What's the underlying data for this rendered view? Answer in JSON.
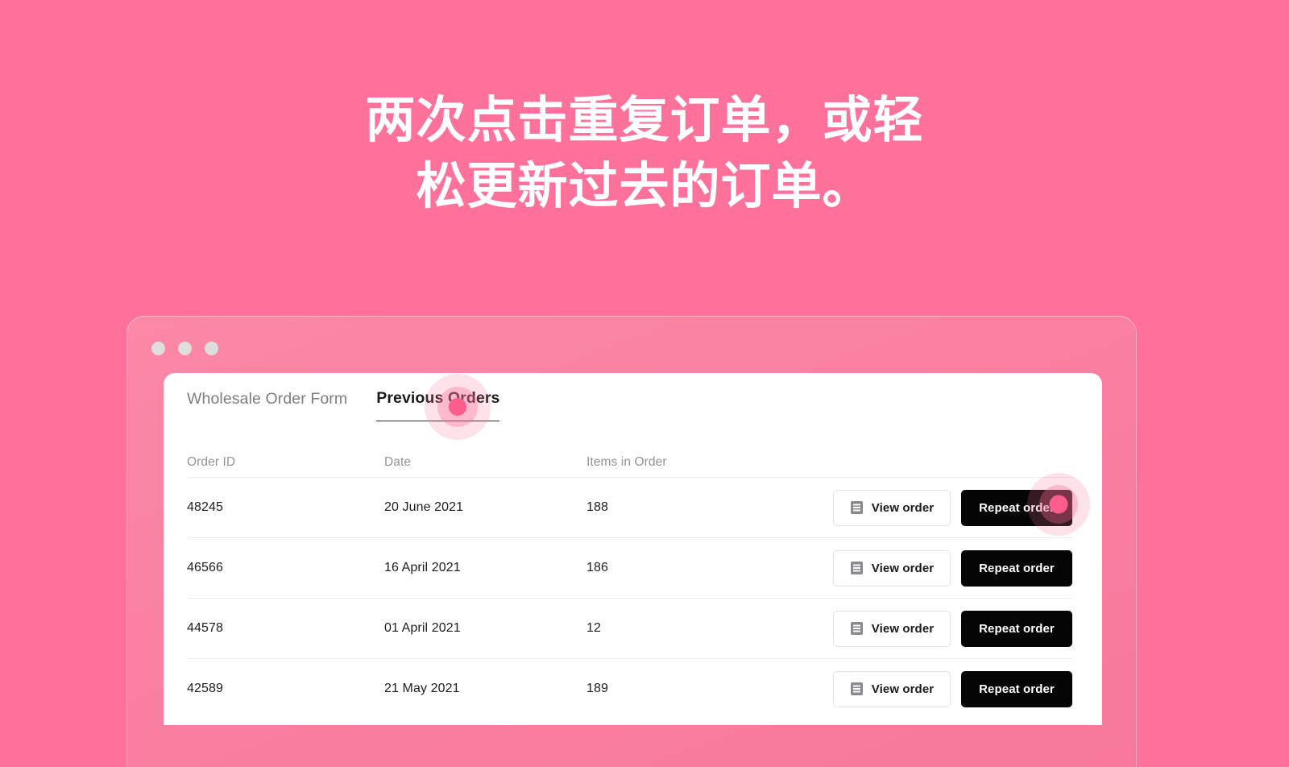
{
  "background_color": "#fd719a",
  "headline": {
    "line1": "两次点击重复订单，或轻",
    "line2": "松更新过去的订单。",
    "color": "#ffffff"
  },
  "window": {
    "chrome_color": "#f97e9f",
    "dots": [
      "dot-1",
      "dot-2",
      "dot-3"
    ]
  },
  "app": {
    "tabs": [
      {
        "label": "Wholesale Order Form",
        "active": false
      },
      {
        "label": "Previous Orders",
        "active": true
      }
    ],
    "table": {
      "headers": [
        "Order ID",
        "Date",
        "Items in Order"
      ],
      "rows": [
        {
          "order_id": "48245",
          "date": "20 June 2021",
          "items": "188",
          "view_label": "View order",
          "repeat_label": "Repeat order"
        },
        {
          "order_id": "46566",
          "date": "16 April 2021",
          "items": "186",
          "view_label": "View order",
          "repeat_label": "Repeat order"
        },
        {
          "order_id": "44578",
          "date": "01 April 2021",
          "items": "12",
          "view_label": "View order",
          "repeat_label": "Repeat order"
        },
        {
          "order_id": "42589",
          "date": "21 May 2021",
          "items": "189",
          "view_label": "View order",
          "repeat_label": "Repeat order"
        }
      ]
    },
    "icons": {
      "view_order": "receipt-icon"
    },
    "button_colors": {
      "repeat_background": "#050505",
      "repeat_text": "#ffffff",
      "view_background": "#ffffff",
      "view_text": "#1b1b1b"
    }
  },
  "click_indicators": [
    {
      "name": "previous-orders-tab",
      "color": "#fb5e8d"
    },
    {
      "name": "repeat-order-row-1",
      "color": "#fb5e8d"
    }
  ]
}
